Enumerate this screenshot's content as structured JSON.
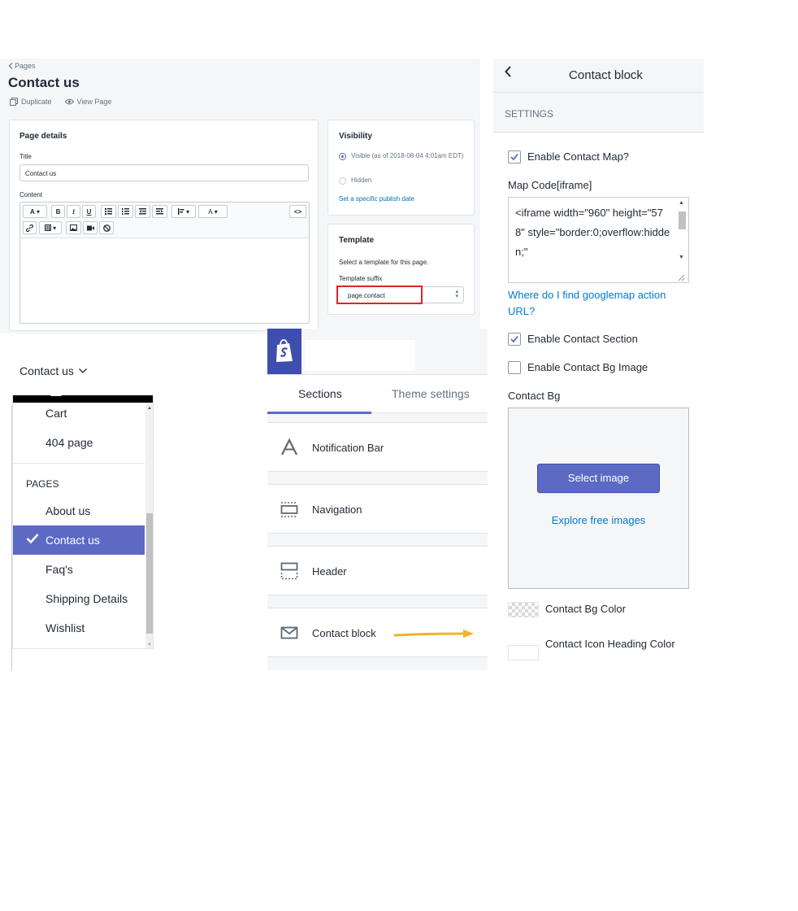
{
  "page_editor": {
    "breadcrumb": "Pages",
    "title": "Contact us",
    "actions": {
      "duplicate": "Duplicate",
      "view_page": "View Page"
    },
    "details": {
      "heading": "Page details",
      "title_label": "Title",
      "title_value": "Contact us",
      "content_label": "Content"
    },
    "visibility": {
      "heading": "Visibility",
      "visible": "Visible (as of 2018-08-04 4:01am EDT)",
      "hidden": "Hidden",
      "publish_link": "Set a specific publish date"
    },
    "template": {
      "heading": "Template",
      "desc": "Select a template for this page.",
      "suffix_label": "Template suffix",
      "suffix_value": "page.contact"
    },
    "toolbar": {
      "font": "A",
      "bold": "B",
      "italic": "I",
      "underline": "U",
      "code": "<>"
    }
  },
  "dropdown": {
    "trigger": "Contact us",
    "items_top": [
      "Cart",
      "404 page"
    ],
    "header": "PAGES",
    "pages": [
      "About us",
      "Contact us",
      "Faq's",
      "Shipping Details",
      "Wishlist"
    ],
    "selected": "Contact us"
  },
  "sections_panel": {
    "tabs": [
      "Sections",
      "Theme settings"
    ],
    "sections": [
      "Notification Bar",
      "Navigation",
      "Header",
      "Contact block"
    ]
  },
  "contact_block": {
    "title": "Contact block",
    "settings_header": "SETTINGS",
    "enable_map": "Enable Contact Map?",
    "map_code_label": "Map Code[iframe]",
    "map_code_value": "<iframe width=\"960\" height=\"578\" style=\"border:0;overflow:hidden;\"",
    "map_help": "Where do I find googlemap action URL?",
    "enable_section": "Enable Contact Section",
    "enable_bg_image": "Enable Contact Bg Image",
    "bg_label": "Contact Bg",
    "select_image": "Select image",
    "explore_images": "Explore free images",
    "bg_color": "Contact Bg Color",
    "icon_heading_color": "Contact Icon Heading Color"
  },
  "colors": {
    "accent": "#5c6ac4",
    "brand": "#3f4eae",
    "link": "#007ace",
    "highlight": "#e32425",
    "arrow": "#f0b429"
  }
}
